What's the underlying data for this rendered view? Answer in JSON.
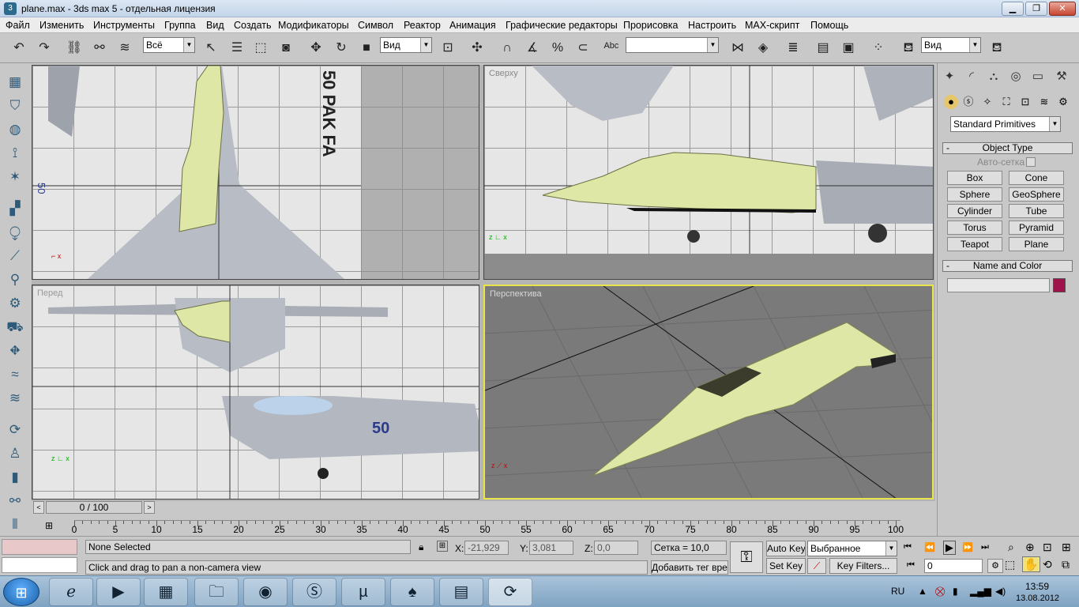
{
  "window": {
    "title": "plane.max - 3ds max 5 - отдельная лицензия",
    "minimize": "▁",
    "maximize": "❐",
    "close": "✕"
  },
  "menu": [
    "Файл",
    "Изменить",
    "Инструменты",
    "Группа",
    "Вид",
    "Создать",
    "Модификаторы",
    "Символ",
    "Реактор",
    "Анимация",
    "Графические редакторы",
    "Прорисовка",
    "Настроить",
    "MAX-скрипт",
    "Помощь"
  ],
  "toolbar": {
    "selection_filter": "Всё",
    "ref_coord": "Вид",
    "named_selection": "",
    "view_combo": "Вид"
  },
  "viewports": {
    "top": {
      "label": "",
      "marking": "50 PAK FA"
    },
    "front": {
      "label": "Сверху"
    },
    "left": {
      "label": "Перед",
      "number": "50"
    },
    "perspective": {
      "label": "Перспектива"
    }
  },
  "command_panel": {
    "category": "Standard Primitives",
    "object_type_title": "Object Type",
    "autogrid_label": "Авто-сетка",
    "buttons": [
      "Box",
      "Cone",
      "Sphere",
      "GeoSphere",
      "Cylinder",
      "Tube",
      "Torus",
      "Pyramid",
      "Teapot",
      "Plane"
    ],
    "name_color_title": "Name and Color",
    "name_value": "",
    "object_color": "#a0124a"
  },
  "timeline": {
    "frame": "0 / 100",
    "ticks": [
      "0",
      "5",
      "10",
      "15",
      "20",
      "25",
      "30",
      "35",
      "40",
      "45",
      "50",
      "55",
      "60",
      "65",
      "70",
      "75",
      "80",
      "85",
      "90",
      "95",
      "100"
    ]
  },
  "status": {
    "selection": "None Selected",
    "prompt": "Click and drag to pan a non-camera view",
    "x_label": "X:",
    "x_value": "-21,929",
    "y_label": "Y:",
    "y_value": "3,081",
    "z_label": "Z:",
    "z_value": "0,0",
    "grid": "Сетка = 10,0",
    "add_time_tag": "Добавить тег времени",
    "auto_key": "Auto Key",
    "set_key": "Set Key",
    "key_mode": "Выбранное",
    "key_filters": "Key Filters...",
    "current_frame": "0"
  },
  "taskbar": {
    "lang": "RU",
    "time": "13:59",
    "date": "13.08.2012"
  }
}
